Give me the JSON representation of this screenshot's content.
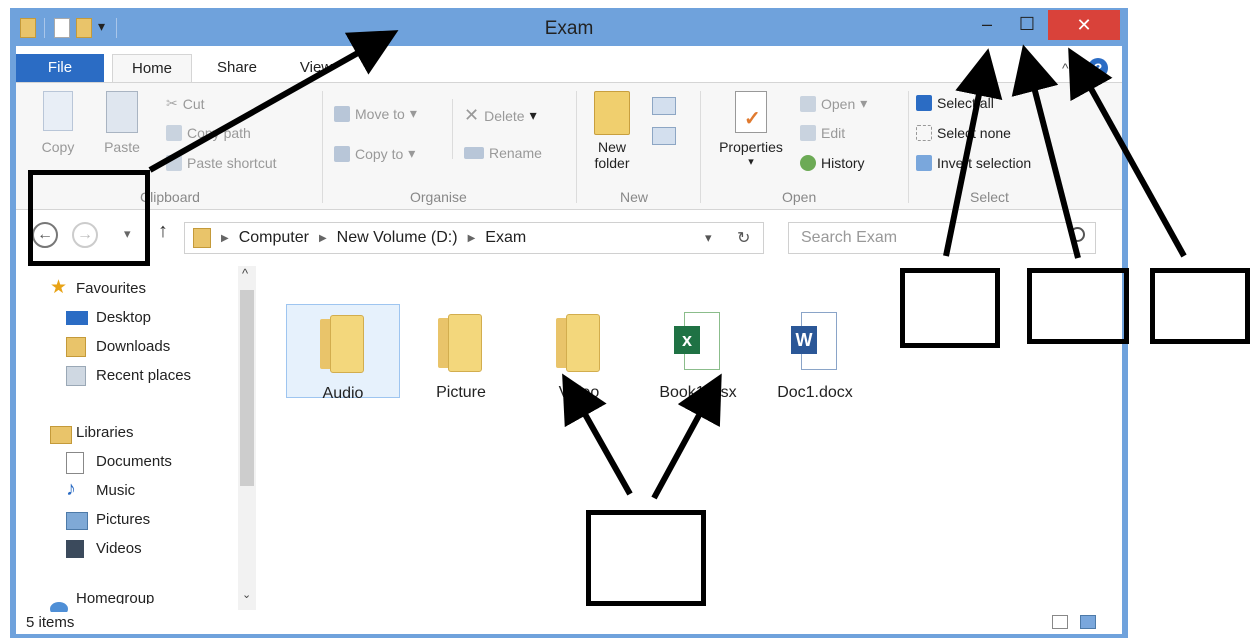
{
  "window": {
    "title": "Exam"
  },
  "title_controls": {
    "minimize": "–",
    "maximize": "☐",
    "close": "✕"
  },
  "tabs": [
    {
      "label": "File"
    },
    {
      "label": "Home"
    },
    {
      "label": "Share"
    },
    {
      "label": "View"
    }
  ],
  "ribbon": {
    "clipboard": {
      "copy": "Copy",
      "paste": "Paste",
      "cut": "Cut",
      "copy_path": "Copy path",
      "paste_shortcut": "Paste shortcut",
      "group": "Clipboard"
    },
    "organise": {
      "move_to": "Move to",
      "copy_to": "Copy to",
      "delete": "Delete",
      "rename": "Rename",
      "group": "Organise"
    },
    "new": {
      "new_folder_1": "New",
      "new_folder_2": "folder",
      "group": "New"
    },
    "open": {
      "properties": "Properties",
      "open": "Open",
      "edit": "Edit",
      "history": "History",
      "group": "Open"
    },
    "select": {
      "select_all": "Select all",
      "select_none": "Select none",
      "invert": "Invert selection",
      "group": "Select"
    }
  },
  "address": {
    "crumbs": [
      "Computer",
      "New Volume (D:)",
      "Exam"
    ],
    "search_placeholder": "Search Exam"
  },
  "nav": {
    "favourites": "Favourites",
    "desktop": "Desktop",
    "downloads": "Downloads",
    "recent": "Recent places",
    "libraries": "Libraries",
    "documents": "Documents",
    "music": "Music",
    "pictures": "Pictures",
    "videos": "Videos",
    "homegroup": "Homegroup"
  },
  "files": [
    {
      "name": "Audio",
      "type": "folder"
    },
    {
      "name": "Picture",
      "type": "folder"
    },
    {
      "name": "Video",
      "type": "folder"
    },
    {
      "name": "Book1.xlsx",
      "type": "excel"
    },
    {
      "name": "Doc1.docx",
      "type": "word"
    }
  ],
  "status": {
    "items": "5 items"
  },
  "colors": {
    "frame": "#6fa2dc",
    "file_tab": "#2b6cc4",
    "close": "#d9423a",
    "excel": "#1f7244",
    "word": "#2b5797"
  }
}
